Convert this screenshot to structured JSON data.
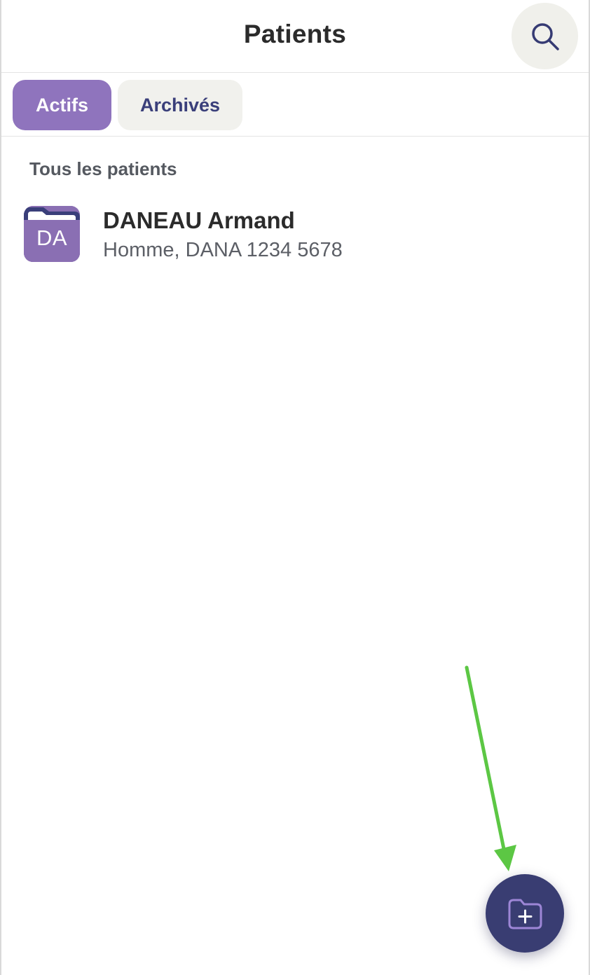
{
  "header": {
    "title": "Patients",
    "search_icon": "search-icon"
  },
  "tabs": [
    {
      "label": "Actifs",
      "active": true
    },
    {
      "label": "Archivés",
      "active": false
    }
  ],
  "section": {
    "title": "Tous les patients"
  },
  "patients": [
    {
      "initials": "DA",
      "name": "DANEAU Armand",
      "details": "Homme, DANA 1234 5678",
      "avatar_icon": "folder-icon"
    }
  ],
  "fab": {
    "icon": "folder-plus-icon"
  },
  "colors": {
    "accent_purple": "#8f74bd",
    "navy": "#393d72",
    "tab_inactive_bg": "#f1f1ed",
    "annotation_arrow": "#5cc744"
  }
}
